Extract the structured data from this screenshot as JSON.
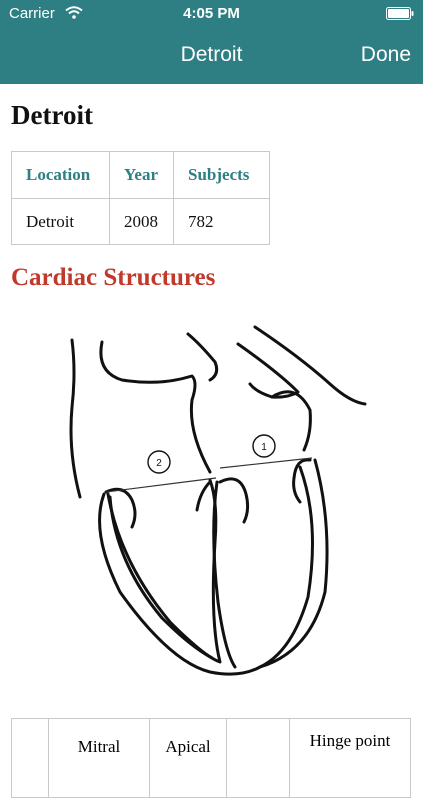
{
  "status_bar": {
    "carrier": "Carrier",
    "time": "4:05 PM"
  },
  "nav": {
    "title": "Detroit",
    "done_label": "Done"
  },
  "page": {
    "heading": "Detroit"
  },
  "info_table": {
    "headers": [
      "Location",
      "Year",
      "Subjects"
    ],
    "row": [
      "Detroit",
      "2008",
      "782"
    ]
  },
  "section": {
    "title": "Cardiac Structures"
  },
  "diagram": {
    "labels": [
      "2",
      "1"
    ]
  },
  "bottom_table": {
    "cells": [
      "",
      "Mitral",
      "Apical",
      "",
      "Hinge point"
    ]
  },
  "colors": {
    "nav_bg": "#2e7f83",
    "header_text": "#2e7f83",
    "section_title": "#c0392b"
  },
  "icons": {
    "wifi": "wifi-icon",
    "battery": "battery-icon"
  }
}
